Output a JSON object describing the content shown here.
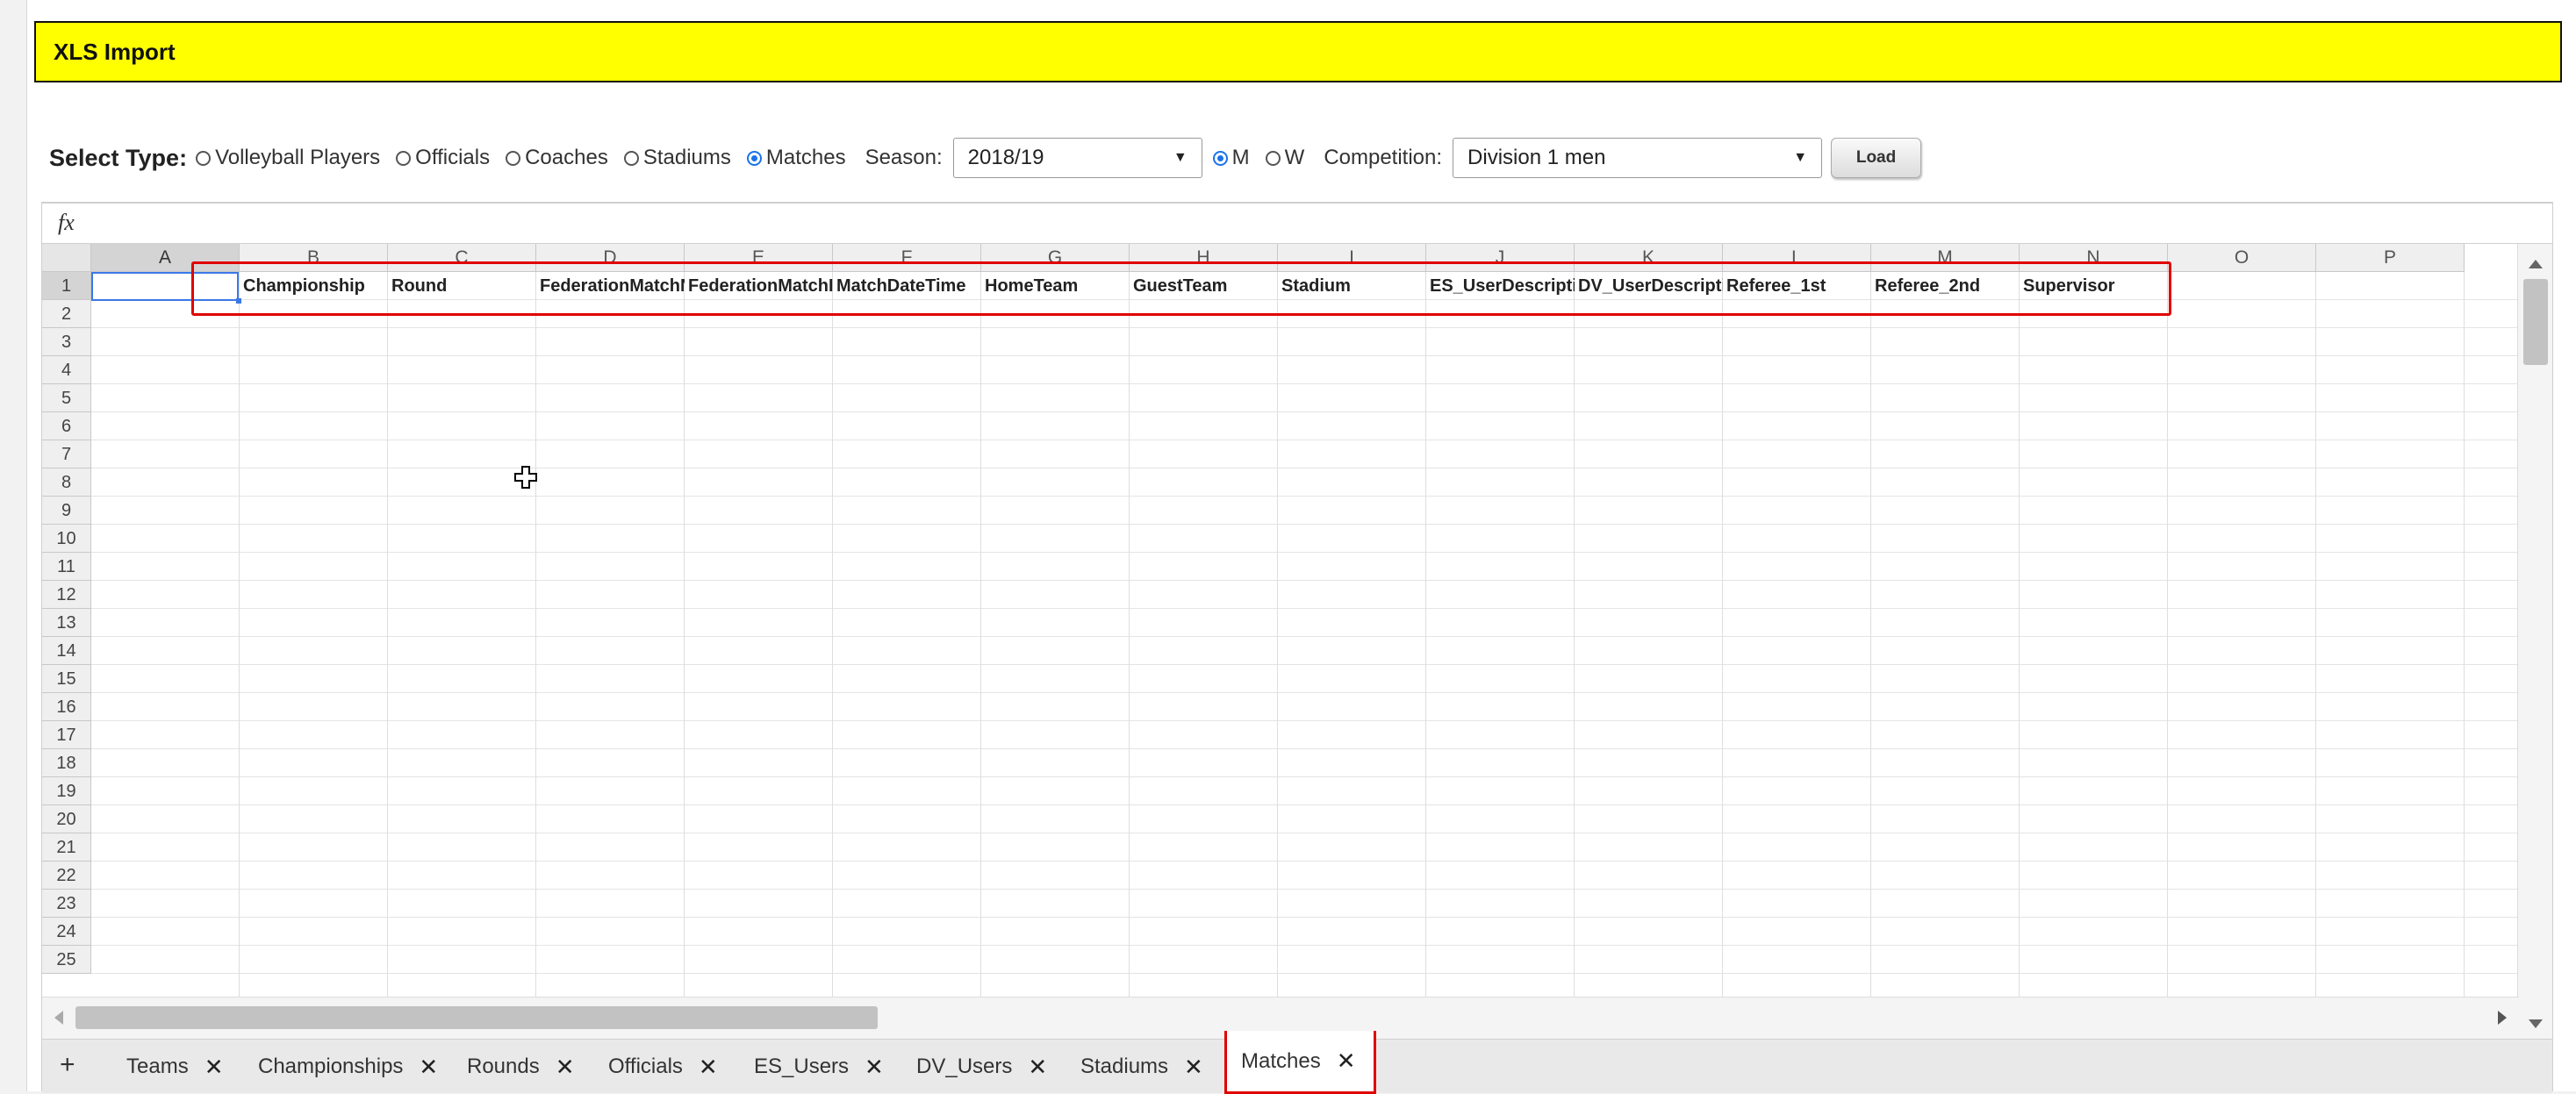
{
  "title": "XLS Import",
  "toolbar": {
    "select_type_label": "Select Type:",
    "types": [
      {
        "label": "Volleyball Players",
        "checked": false
      },
      {
        "label": "Officials",
        "checked": false
      },
      {
        "label": "Coaches",
        "checked": false
      },
      {
        "label": "Stadiums",
        "checked": false
      },
      {
        "label": "Matches",
        "checked": true
      }
    ],
    "season_label": "Season:",
    "season_value": "2018/19",
    "genders": [
      {
        "label": "M",
        "checked": true
      },
      {
        "label": "W",
        "checked": false
      }
    ],
    "competition_label": "Competition:",
    "competition_value": "Division 1 men",
    "load_label": "Load"
  },
  "sheet": {
    "fx_label": "fx",
    "columns": [
      "A",
      "B",
      "C",
      "D",
      "E",
      "F",
      "G",
      "H",
      "I",
      "J",
      "K",
      "L",
      "M",
      "N",
      "O",
      "P"
    ],
    "rows": [
      "1",
      "2",
      "3",
      "4",
      "5",
      "6",
      "7",
      "8",
      "9",
      "10",
      "11",
      "12",
      "13",
      "14",
      "15",
      "16",
      "17",
      "18",
      "19",
      "20",
      "21",
      "22",
      "23",
      "24",
      "25"
    ],
    "active_column": "A",
    "active_row": "1",
    "row1_values": [
      "",
      "Championship",
      "Round",
      "FederationMatchNumber",
      "FederationMatchID",
      "MatchDateTime",
      "HomeTeam",
      "GuestTeam",
      "Stadium",
      "ES_UserDescription",
      "DV_UserDescription",
      "Referee_1st",
      "Referee_2nd",
      "Supervisor"
    ]
  },
  "tabs": {
    "add_label": "+",
    "close_label": "✕",
    "items": [
      {
        "label": "Teams",
        "active": false
      },
      {
        "label": "Championships",
        "active": false
      },
      {
        "label": "Rounds",
        "active": false
      },
      {
        "label": "Officials",
        "active": false
      },
      {
        "label": "ES_Users",
        "active": false
      },
      {
        "label": "DV_Users",
        "active": false
      },
      {
        "label": "Stadiums",
        "active": false
      },
      {
        "label": "Matches",
        "active": true
      }
    ]
  },
  "colors": {
    "title_bg": "#ffff00",
    "highlight": "#e00000",
    "selection": "#3b78e7"
  }
}
